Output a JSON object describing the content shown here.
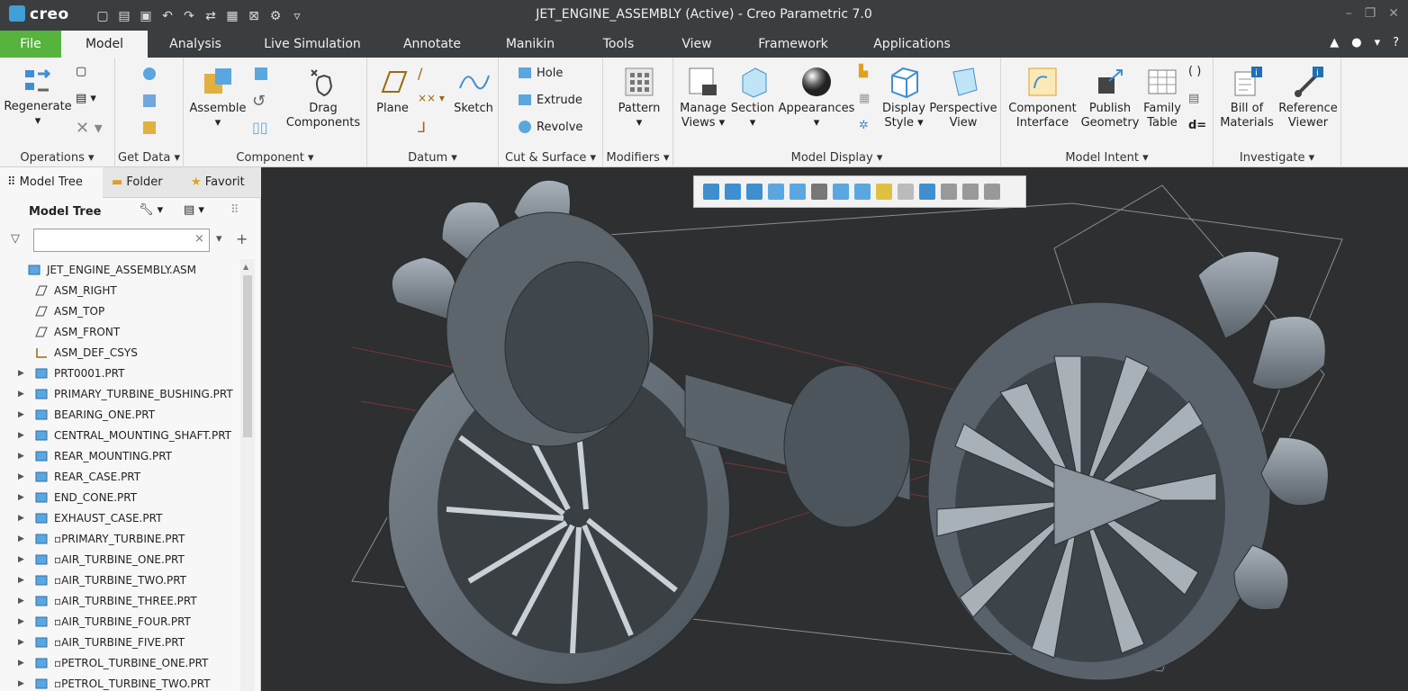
{
  "app": {
    "logo": "creo",
    "title": "JET_ENGINE_ASSEMBLY (Active) - Creo Parametric 7.0"
  },
  "tabs": [
    "File",
    "Model",
    "Analysis",
    "Live Simulation",
    "Annotate",
    "Manikin",
    "Tools",
    "View",
    "Framework",
    "Applications"
  ],
  "ribbon": {
    "operations": {
      "label": "Operations ▾",
      "regenerate": "Regenerate"
    },
    "get_data": {
      "label": "Get Data ▾"
    },
    "component": {
      "label": "Component ▾",
      "assemble": "Assemble",
      "drag": "Drag Components"
    },
    "datum": {
      "label": "Datum ▾",
      "plane": "Plane",
      "sketch": "Sketch"
    },
    "cut_surface": {
      "label": "Cut & Surface ▾",
      "hole": "Hole",
      "extrude": "Extrude",
      "revolve": "Revolve"
    },
    "modifiers": {
      "label": "Modifiers ▾",
      "pattern": "Pattern"
    },
    "model_display": {
      "label": "Model Display ▾",
      "manage_views": "Manage Views ▾",
      "section": "Section",
      "appearances": "Appearances",
      "display_style": "Display Style ▾",
      "perspective": "Perspective View"
    },
    "model_intent": {
      "label": "Model Intent ▾",
      "component_interface": "Component Interface",
      "publish_geometry": "Publish Geometry",
      "family_table": "Family Table",
      "d_eq": "d="
    },
    "investigate": {
      "label": "Investigate ▾",
      "bom": "Bill of Materials",
      "reference_viewer": "Reference Viewer"
    }
  },
  "left_panel": {
    "tabs": [
      "Model Tree",
      "Folder",
      "Favorit"
    ],
    "tree_header": "Model Tree",
    "filter_placeholder": "",
    "items": [
      {
        "name": "JET_ENGINE_ASSEMBLY.ASM",
        "type": "asm",
        "expand": false,
        "indent": 0
      },
      {
        "name": "ASM_RIGHT",
        "type": "plane",
        "expand": false,
        "indent": 1
      },
      {
        "name": "ASM_TOP",
        "type": "plane",
        "expand": false,
        "indent": 1
      },
      {
        "name": "ASM_FRONT",
        "type": "plane",
        "expand": false,
        "indent": 1
      },
      {
        "name": "ASM_DEF_CSYS",
        "type": "csys",
        "expand": false,
        "indent": 1
      },
      {
        "name": "PRT0001.PRT",
        "type": "part",
        "expand": true,
        "indent": 1
      },
      {
        "name": "PRIMARY_TURBINE_BUSHING.PRT",
        "type": "part",
        "expand": true,
        "indent": 1
      },
      {
        "name": "BEARING_ONE.PRT",
        "type": "part",
        "expand": true,
        "indent": 1
      },
      {
        "name": "CENTRAL_MOUNTING_SHAFT.PRT",
        "type": "part",
        "expand": true,
        "indent": 1
      },
      {
        "name": "REAR_MOUNTING.PRT",
        "type": "part",
        "expand": true,
        "indent": 1
      },
      {
        "name": "REAR_CASE.PRT",
        "type": "part",
        "expand": true,
        "indent": 1
      },
      {
        "name": "END_CONE.PRT",
        "type": "part",
        "expand": true,
        "indent": 1
      },
      {
        "name": "EXHAUST_CASE.PRT",
        "type": "part",
        "expand": true,
        "indent": 1
      },
      {
        "name": "▫PRIMARY_TURBINE.PRT",
        "type": "part",
        "expand": true,
        "indent": 1
      },
      {
        "name": "▫AIR_TURBINE_ONE.PRT",
        "type": "part",
        "expand": true,
        "indent": 1
      },
      {
        "name": "▫AIR_TURBINE_TWO.PRT",
        "type": "part",
        "expand": true,
        "indent": 1
      },
      {
        "name": "▫AIR_TURBINE_THREE.PRT",
        "type": "part",
        "expand": true,
        "indent": 1
      },
      {
        "name": "▫AIR_TURBINE_FOUR.PRT",
        "type": "part",
        "expand": true,
        "indent": 1
      },
      {
        "name": "▫AIR_TURBINE_FIVE.PRT",
        "type": "part",
        "expand": true,
        "indent": 1
      },
      {
        "name": "▫PETROL_TURBINE_ONE.PRT",
        "type": "part",
        "expand": true,
        "indent": 1
      },
      {
        "name": "▫PETROL_TURBINE_TWO.PRT",
        "type": "part",
        "expand": true,
        "indent": 1
      }
    ]
  },
  "colors": {
    "file_tab": "#56b33d",
    "accent": "#3f9fd6",
    "titlebar": "#3b3e40",
    "viewport": "#2d2f31"
  }
}
